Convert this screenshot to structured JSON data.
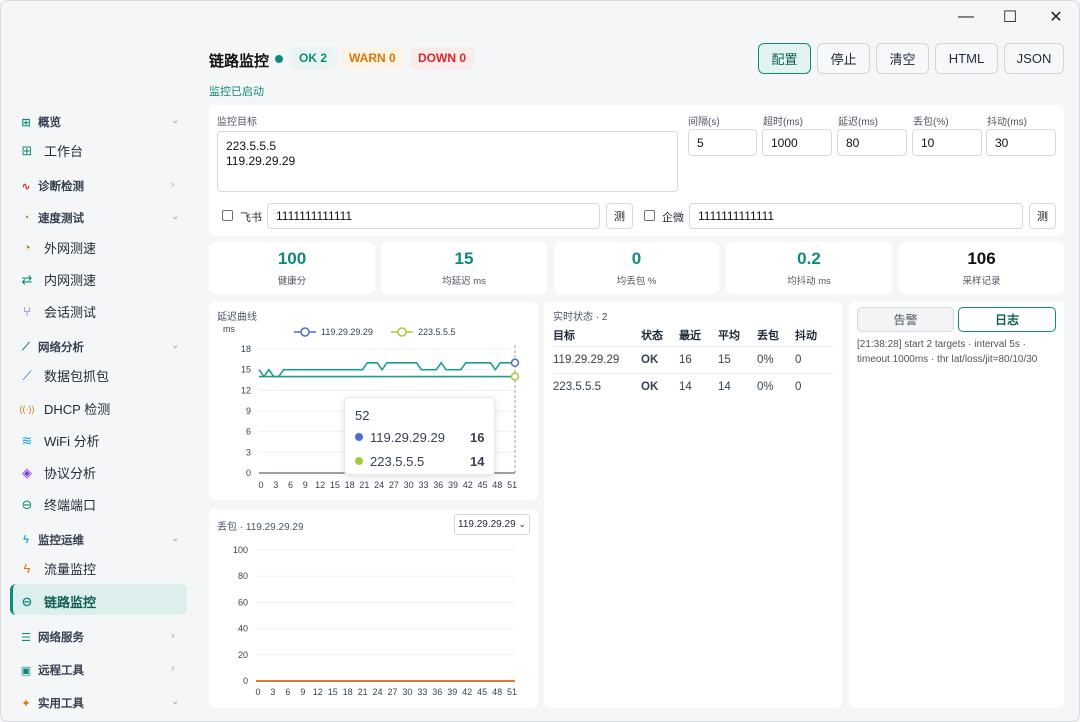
{
  "window": {
    "minimize": "—",
    "maximize": "☐",
    "close": "✕"
  },
  "sidebar": {
    "groups": [
      {
        "label": "概览",
        "icon": "⊞",
        "chev": "⌄"
      },
      {
        "label": "诊断检测",
        "icon": "∿",
        "chev": "›"
      },
      {
        "label": "速度测试",
        "icon": "◔",
        "chev": "⌄"
      },
      {
        "label": "网络分析",
        "icon": "⟋",
        "chev": "⌄"
      },
      {
        "label": "监控运维",
        "icon": "ϟ",
        "chev": "⌄"
      },
      {
        "label": "网络服务",
        "icon": "☰",
        "chev": "›"
      },
      {
        "label": "远程工具",
        "icon": "▣",
        "chev": "›"
      },
      {
        "label": "实用工具",
        "icon": "✦",
        "chev": "⌄"
      }
    ],
    "items": [
      {
        "label": "工作台",
        "icon": "⊞"
      },
      {
        "label": "外网测速",
        "icon": "◔"
      },
      {
        "label": "内网测速",
        "icon": "⇄"
      },
      {
        "label": "会话测试",
        "icon": "⑂"
      },
      {
        "label": "数据包抓包",
        "icon": "⟋"
      },
      {
        "label": "DHCP 检测",
        "icon": "((·))"
      },
      {
        "label": "WiFi 分析",
        "icon": "≋"
      },
      {
        "label": "协议分析",
        "icon": "◈"
      },
      {
        "label": "终端端口",
        "icon": "⊖"
      },
      {
        "label": "流量监控",
        "icon": "ϟ"
      },
      {
        "label": "链路监控",
        "icon": "⊖"
      }
    ]
  },
  "header": {
    "title": "链路监控",
    "ok": "OK 2",
    "warn": "WARN 0",
    "down": "DOWN 0",
    "status": "监控已启动"
  },
  "toolbar": {
    "config": "配置",
    "stop": "停止",
    "clear": "清空",
    "html": "HTML",
    "json": "JSON"
  },
  "form": {
    "targets_label": "监控目标",
    "targets": [
      "223.5.5.5",
      "119.29.29.29"
    ],
    "interval_label": "间隔(s)",
    "interval": "5",
    "timeout_label": "超时(ms)",
    "timeout": "1000",
    "latency_label": "延迟(ms)",
    "latency": "80",
    "loss_label": "丢包(%)",
    "loss": "10",
    "jitter_label": "抖动(ms)",
    "jitter": "30",
    "feishu_label": "飞书",
    "feishu_value": "1111111111111",
    "wecom_label": "企微",
    "wecom_value": "1111111111111",
    "test_label": "测"
  },
  "stats": [
    {
      "value": "100",
      "label": "健康分"
    },
    {
      "value": "15",
      "label": "均延迟 ms"
    },
    {
      "value": "0",
      "label": "均丢包 %"
    },
    {
      "value": "0.2",
      "label": "均抖动 ms"
    },
    {
      "value": "106",
      "label": "采样记录"
    }
  ],
  "latency_panel": {
    "title": "延迟曲线",
    "unit": "ms",
    "tooltip": {
      "x": "52",
      "rows": [
        {
          "name": "119.29.29.29",
          "value": "16"
        },
        {
          "name": "223.5.5.5",
          "value": "14"
        }
      ]
    }
  },
  "loss_panel": {
    "title": "丢包 · 119.29.29.29",
    "select": "119.29.29.29"
  },
  "realtime": {
    "title": "实时状态 · 2",
    "columns": [
      "目标",
      "状态",
      "最近",
      "平均",
      "丢包",
      "抖动"
    ],
    "rows": [
      [
        "119.29.29.29",
        "OK",
        "16",
        "15",
        "0%",
        "0"
      ],
      [
        "223.5.5.5",
        "OK",
        "14",
        "14",
        "0%",
        "0"
      ]
    ]
  },
  "tabs": {
    "alert": "告警",
    "log": "日志"
  },
  "log": [
    "[21:38:28] start 2 targets · interval 5s ·",
    "timeout 1000ms · thr lat/loss/jit=80/10/30"
  ],
  "colors": {
    "accent": "#0f8a7a",
    "warn": "#d97706",
    "down": "#dc2626",
    "s1": "#4a6fd1",
    "s2": "#a8c93a",
    "loss": "#e07b2a"
  },
  "chart_data": [
    {
      "type": "line",
      "title": "延迟曲线",
      "ylabel": "ms",
      "ylim": [
        0,
        18
      ],
      "yticks": [
        0,
        3,
        6,
        9,
        12,
        15,
        18
      ],
      "xticks": [
        0,
        3,
        6,
        9,
        12,
        15,
        18,
        21,
        24,
        27,
        30,
        33,
        36,
        39,
        42,
        45,
        48,
        51
      ],
      "legend": "top",
      "x": [
        0,
        1,
        2,
        3,
        4,
        5,
        6,
        7,
        8,
        9,
        10,
        11,
        12,
        13,
        14,
        15,
        16,
        17,
        18,
        19,
        20,
        21,
        22,
        23,
        24,
        25,
        26,
        27,
        28,
        29,
        30,
        31,
        32,
        33,
        34,
        35,
        36,
        37,
        38,
        39,
        40,
        41,
        42,
        43,
        44,
        45,
        46,
        47,
        48,
        49,
        50,
        51,
        52
      ],
      "series": [
        {
          "name": "119.29.29.29",
          "values": [
            15,
            14,
            15,
            14,
            14,
            15,
            15,
            15,
            15,
            15,
            15,
            15,
            15,
            15,
            15,
            15,
            15,
            15,
            15,
            15,
            15,
            15,
            16,
            16,
            16,
            15,
            16,
            16,
            16,
            16,
            16,
            16,
            16,
            15,
            15,
            15,
            15,
            16,
            15,
            15,
            15,
            15,
            16,
            16,
            16,
            16,
            16,
            16,
            15,
            16,
            16,
            16,
            16
          ]
        },
        {
          "name": "223.5.5.5",
          "values": [
            14,
            14,
            14,
            14,
            14,
            14,
            14,
            14,
            14,
            14,
            14,
            14,
            14,
            14,
            14,
            14,
            14,
            14,
            14,
            14,
            14,
            14,
            14,
            14,
            14,
            14,
            14,
            14,
            14,
            14,
            14,
            14,
            14,
            14,
            14,
            14,
            14,
            14,
            14,
            14,
            14,
            14,
            14,
            14,
            14,
            14,
            14,
            14,
            14,
            14,
            14,
            14,
            14
          ]
        }
      ]
    },
    {
      "type": "line",
      "title": "丢包 · 119.29.29.29",
      "ylim": [
        0,
        100
      ],
      "yticks": [
        0,
        20,
        40,
        60,
        80,
        100
      ],
      "xticks": [
        0,
        3,
        6,
        9,
        12,
        15,
        18,
        21,
        24,
        27,
        30,
        33,
        36,
        39,
        42,
        45,
        48,
        51
      ],
      "series": [
        {
          "name": "119.29.29.29",
          "values": [
            0,
            0,
            0,
            0,
            0,
            0,
            0,
            0,
            0,
            0,
            0,
            0,
            0,
            0,
            0,
            0,
            0,
            0,
            0,
            0,
            0,
            0,
            0,
            0,
            0,
            0,
            0,
            0,
            0,
            0,
            0,
            0,
            0,
            0,
            0,
            0,
            0,
            0,
            0,
            0,
            0,
            0,
            0,
            0,
            0,
            0,
            0,
            0,
            0,
            0,
            0,
            0,
            0
          ]
        }
      ]
    }
  ]
}
